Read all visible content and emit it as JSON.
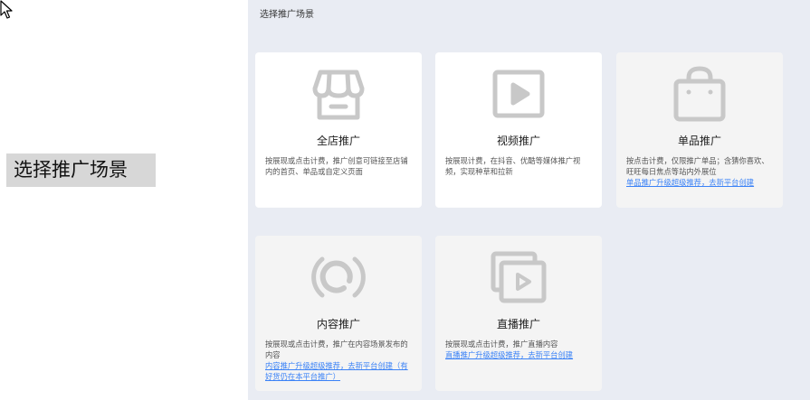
{
  "left_heading": "选择推广场景",
  "panel_title": "选择推广场景",
  "colors": {
    "panel_bg": "#e9ecf3",
    "card_bg": "#ffffff",
    "card_disabled_bg": "#f4f4f4",
    "icon_gray": "#c8c8c8",
    "link_blue": "#3b82f6"
  },
  "cards": [
    {
      "title": "全店推广",
      "icon": "storefront-icon",
      "description": "按展现或点击计费，推广创意可链接至店铺内的首页、单品或自定义页面",
      "link": ""
    },
    {
      "title": "视频推广",
      "icon": "video-play-icon",
      "description": "按展现计费，在抖音、优酷等媒体推广视频，实现种草和拉新",
      "link": ""
    },
    {
      "title": "单品推广",
      "icon": "shopping-bag-icon",
      "description": "按点击计费，仅限推广单品；含猜你喜欢、旺旺每日焦点等站内外展位",
      "link": "单品推广升级超级推荐，去新平台创建"
    },
    {
      "title": "内容推广",
      "icon": "content-ring-icon",
      "description": "按展现或点击计费，推广在内容场景发布的内容",
      "link": "内容推广升级超级推荐，去新平台创建（有好货仍在本平台推广）"
    },
    {
      "title": "直播推广",
      "icon": "live-stream-icon",
      "description": "按展现或点击计费，推广直播内容",
      "link": "直播推广升级超级推荐，去新平台创建"
    }
  ]
}
